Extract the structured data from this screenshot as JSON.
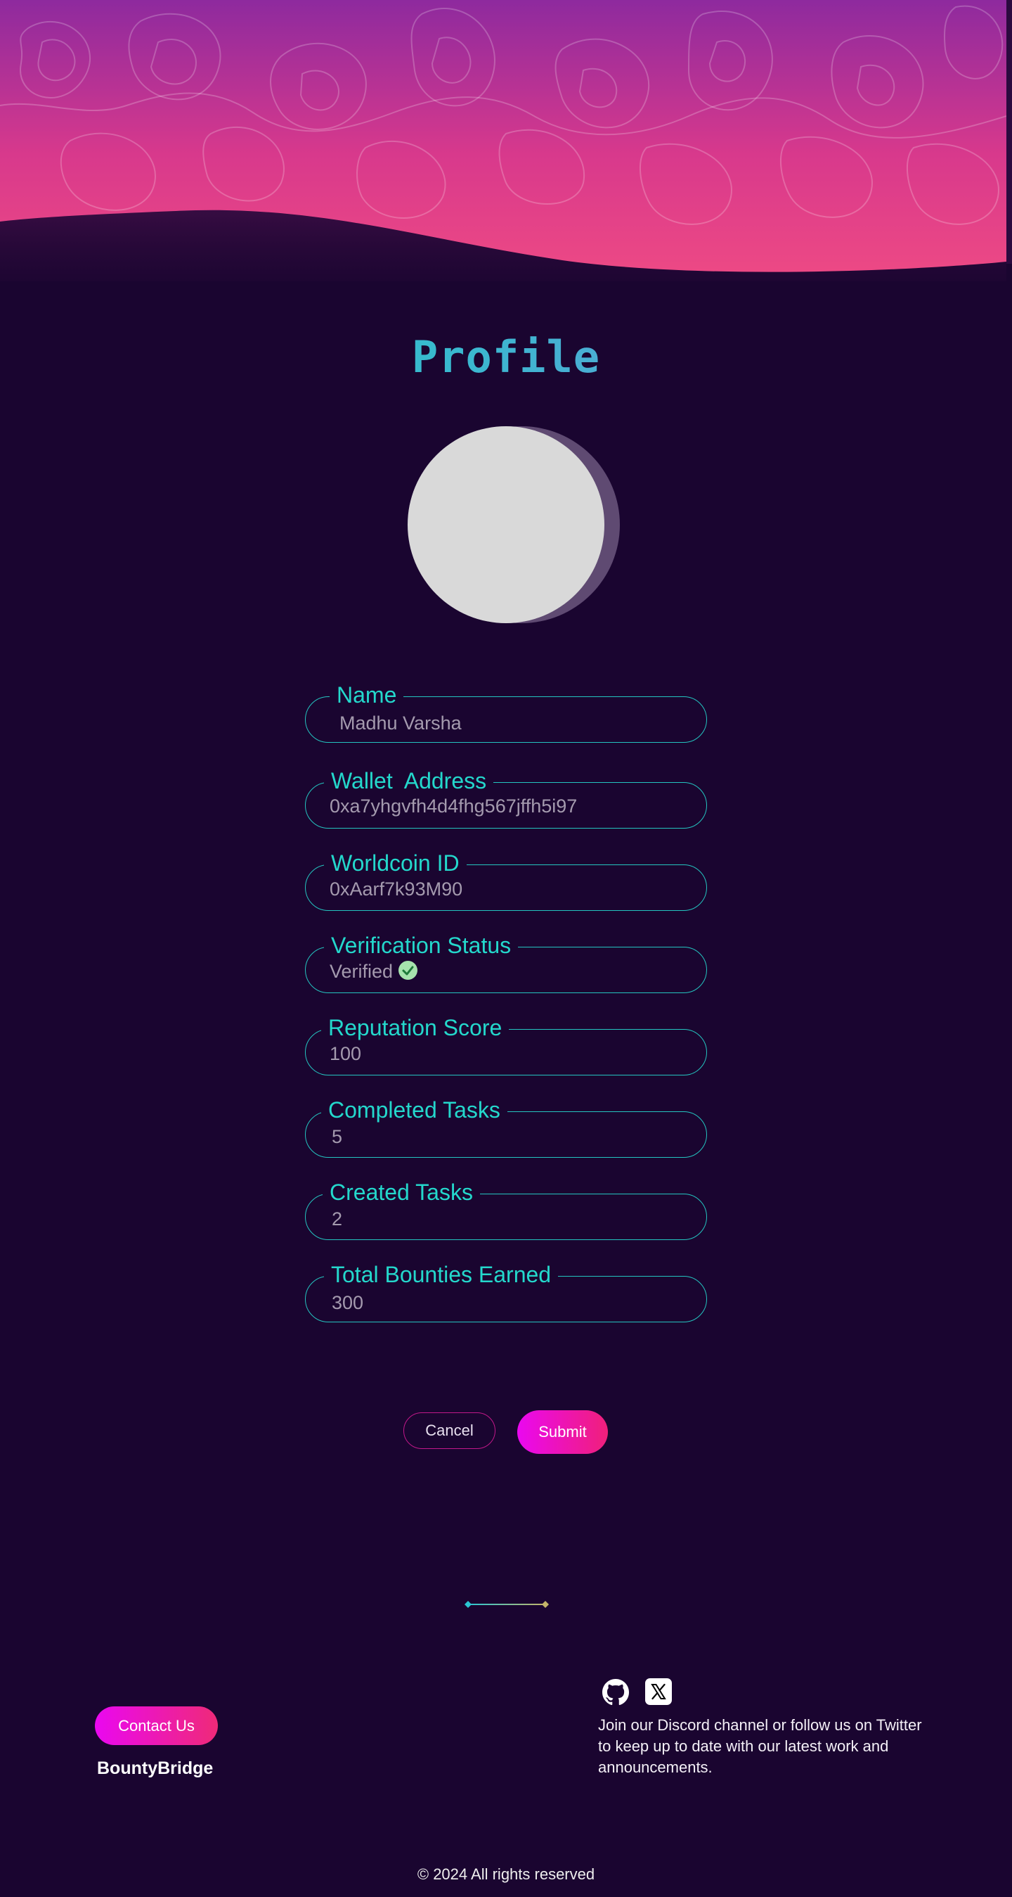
{
  "page": {
    "title": "Profile"
  },
  "fields": [
    {
      "label": "Name",
      "value": "Madhu Varsha"
    },
    {
      "label": "Wallet  Address",
      "value": "0xa7yhgvfh4d4fhg567jffh5i97"
    },
    {
      "label": "Worldcoin ID",
      "value": "0xAarf7k93M90"
    },
    {
      "label": "Verification Status",
      "value": "Verified"
    },
    {
      "label": "Reputation Score",
      "value": "100"
    },
    {
      "label": "Completed Tasks",
      "value": "5"
    },
    {
      "label": "Created Tasks",
      "value": "2"
    },
    {
      "label": "Total Bounties Earned",
      "value": "300"
    }
  ],
  "actions": {
    "cancel": "Cancel",
    "submit": "Submit"
  },
  "footer": {
    "contact": "Contact Us",
    "brand": "BountyBridge",
    "text": "Join our Discord channel or follow us on Twitter to keep up to date with our latest work and announcements.",
    "copyright": "© 2024 All rights reserved",
    "icons": [
      "github-icon",
      "x-twitter-icon"
    ]
  },
  "colors": {
    "background": "#1a0530",
    "accent_teal": "#24c5c0",
    "accent_pink": "#ea08f0",
    "hero_top": "#8e2a9e",
    "hero_bottom": "#ee4a84"
  }
}
